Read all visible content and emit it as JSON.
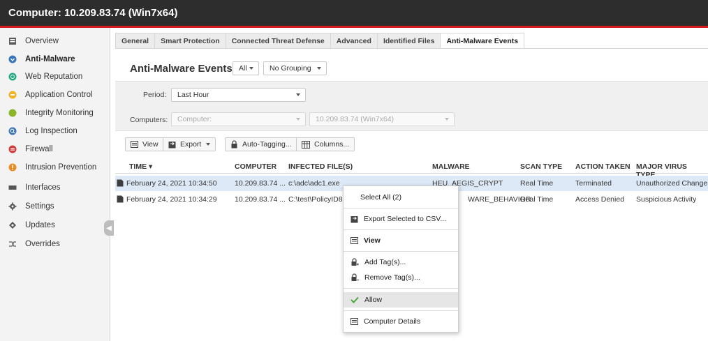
{
  "window": {
    "title": "Computer: 10.209.83.74 (Win7x64)"
  },
  "sidebar": {
    "items": [
      {
        "label": "Overview",
        "icon": "overview-icon",
        "color": "#5a5a5a"
      },
      {
        "label": "Anti-Malware",
        "icon": "anti-malware-icon",
        "color": "#3a76b8",
        "active": true
      },
      {
        "label": "Web Reputation",
        "icon": "web-reputation-icon",
        "color": "#21a77f"
      },
      {
        "label": "Application Control",
        "icon": "application-control-icon",
        "color": "#f2b322"
      },
      {
        "label": "Integrity Monitoring",
        "icon": "integrity-monitoring-icon",
        "color": "#8bb529"
      },
      {
        "label": "Log Inspection",
        "icon": "log-inspection-icon",
        "color": "#3a76b8"
      },
      {
        "label": "Firewall",
        "icon": "firewall-icon",
        "color": "#d33a3a"
      },
      {
        "label": "Intrusion Prevention",
        "icon": "intrusion-prevention-icon",
        "color": "#ef8a1e"
      },
      {
        "label": "Interfaces",
        "icon": "interfaces-icon",
        "color": "#555555"
      },
      {
        "label": "Settings",
        "icon": "settings-gear-icon",
        "color": "#555555"
      },
      {
        "label": "Updates",
        "icon": "updates-icon",
        "color": "#555555"
      },
      {
        "label": "Overrides",
        "icon": "overrides-icon",
        "color": "#555555"
      }
    ]
  },
  "tabs": [
    {
      "label": "General"
    },
    {
      "label": "Smart Protection"
    },
    {
      "label": "Connected Threat Defense"
    },
    {
      "label": "Advanced"
    },
    {
      "label": "Identified Files"
    },
    {
      "label": "Anti-Malware Events",
      "active": true
    }
  ],
  "header": {
    "title": "Anti-Malware Events",
    "scope_select": "All",
    "grouping_select": "No Grouping"
  },
  "filters": {
    "period_label": "Period:",
    "period_value": "Last Hour",
    "computers_label": "Computers:",
    "computers_value": "Computer:",
    "computers_target": "10.209.83.74 (Win7x64)"
  },
  "toolbar": {
    "view_label": "View",
    "export_label": "Export",
    "auto_tagging_label": "Auto-Tagging...",
    "columns_label": "Columns..."
  },
  "table": {
    "columns": [
      "TIME",
      "COMPUTER",
      "INFECTED FILE(S)",
      "MALWARE",
      "SCAN TYPE",
      "ACTION TAKEN",
      "MAJOR VIRUS TYPE"
    ],
    "rows": [
      {
        "time": "February 24, 2021 10:34:50",
        "computer": "10.209.83.74 ...",
        "file": "c:\\adc\\adc1.exe",
        "malware": "HEU_AEGIS_CRYPT",
        "scan": "Real Time",
        "action": "Terminated",
        "virus_type": "Unauthorized Change",
        "selected": true
      },
      {
        "time": "February 24, 2021 10:34:29",
        "computer": "10.209.83.74 ...",
        "file": "C:\\test\\PolicyID85",
        "malware": "WARE_BEHAVIOR",
        "scan": "Real Time",
        "action": "Access Denied",
        "virus_type": "Suspicious Activity",
        "selected": false
      }
    ]
  },
  "context_menu": {
    "select_all": "Select All (2)",
    "export_csv": "Export Selected to CSV...",
    "view": "View",
    "add_tags": "Add Tag(s)...",
    "remove_tags": "Remove Tag(s)...",
    "allow": "Allow",
    "computer_details": "Computer Details"
  },
  "colors": {
    "titlebar": "#2d2d2d",
    "accent_red": "#d71920",
    "selection": "#dde9f6",
    "allow_check": "#4aa83f"
  }
}
